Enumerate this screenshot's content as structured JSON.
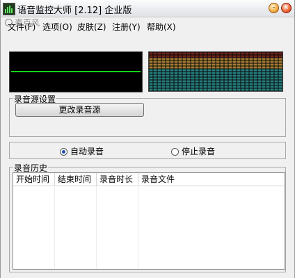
{
  "window": {
    "title": "语音监控大师 [2.12] 企业版",
    "minimize_glyph": "–",
    "close_glyph": "×"
  },
  "menu": {
    "items": [
      {
        "label": "文件(F)"
      },
      {
        "label": "选项(O)"
      },
      {
        "label": "皮肤(Z)"
      },
      {
        "label": "注册(Y)"
      },
      {
        "label": "帮助(X)"
      }
    ]
  },
  "mic_overlay_text": "麦克风",
  "source_group": {
    "legend": "录音源设置",
    "change_button_label": "更改录音源"
  },
  "mode": {
    "auto_label": "自动录音",
    "stop_label": "停止录音",
    "selected": "auto"
  },
  "history": {
    "legend": "录音历史",
    "columns": [
      "开始时间",
      "结束时间",
      "录音时长",
      "录音文件"
    ],
    "rows": []
  },
  "colors": {
    "scope_trace": "#17d317",
    "spectrum_top": "#c0392b",
    "spectrum_mid": "#d9a441",
    "spectrum_low": "#2fa6a6"
  }
}
